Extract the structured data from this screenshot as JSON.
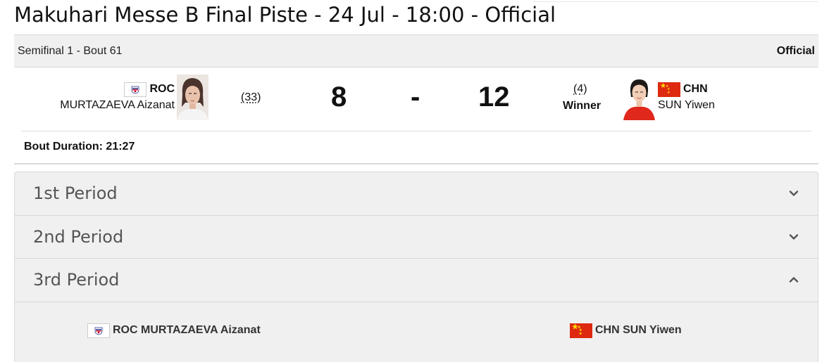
{
  "page": {
    "title": "Makuhari Messe B Final Piste - 24 Jul - 18:00 - Official"
  },
  "bout": {
    "label": "Semifinal 1 - Bout 61",
    "status": "Official",
    "duration_label": "Bout Duration: 21:27"
  },
  "left_athlete": {
    "noc": "ROC",
    "name": "MURTAZAEVA Aizanat",
    "seed": "(33)",
    "score": "8",
    "flag_icon": "roc-flag-icon"
  },
  "separator": "-",
  "right_athlete": {
    "noc": "CHN",
    "name": "SUN Yiwen",
    "seed": "(4)",
    "result": "Winner",
    "score": "12",
    "flag_icon": "chn-flag-icon"
  },
  "periods": [
    {
      "label": "1st Period",
      "expanded": false,
      "icon": "chevron-down-icon"
    },
    {
      "label": "2nd Period",
      "expanded": false,
      "icon": "chevron-down-icon"
    },
    {
      "label": "3rd Period",
      "expanded": true,
      "icon": "chevron-up-icon"
    }
  ],
  "period_detail": {
    "left": "ROC MURTAZAEVA Aizanat",
    "right": "CHN SUN Yiwen"
  },
  "colors": {
    "header_bg": "#f0f0f0",
    "border": "#d8d8d8",
    "chn_red": "#de2910",
    "chn_yellow": "#ffde00"
  }
}
